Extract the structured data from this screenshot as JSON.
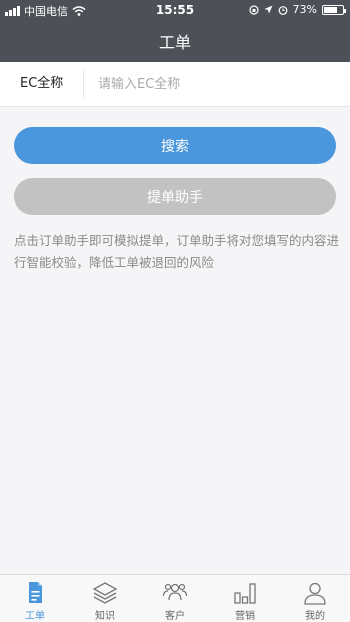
{
  "status_bar": {
    "carrier": "中国电信",
    "time": "15:55",
    "battery_percent": "73%",
    "battery_level": 0.73
  },
  "header": {
    "title": "工单"
  },
  "form": {
    "label": "EC全称",
    "placeholder": "请输入EC全称",
    "value": ""
  },
  "buttons": {
    "search": "搜索",
    "helper": "提单助手"
  },
  "hint": "点击订单助手即可模拟提单，订单助手将对您填写的内容进行智能校验，降低工单被退回的风险",
  "tabs": [
    {
      "label": "工单",
      "icon": "document-icon",
      "active": true
    },
    {
      "label": "知识",
      "icon": "layers-icon",
      "active": false
    },
    {
      "label": "客户",
      "icon": "customers-icon",
      "active": false
    },
    {
      "label": "营销",
      "icon": "bar-chart-icon",
      "active": false
    },
    {
      "label": "我的",
      "icon": "user-icon",
      "active": false
    }
  ],
  "colors": {
    "header_bg": "#4d5157",
    "primary": "#4b97dd",
    "disabled": "#c2c2c2"
  }
}
